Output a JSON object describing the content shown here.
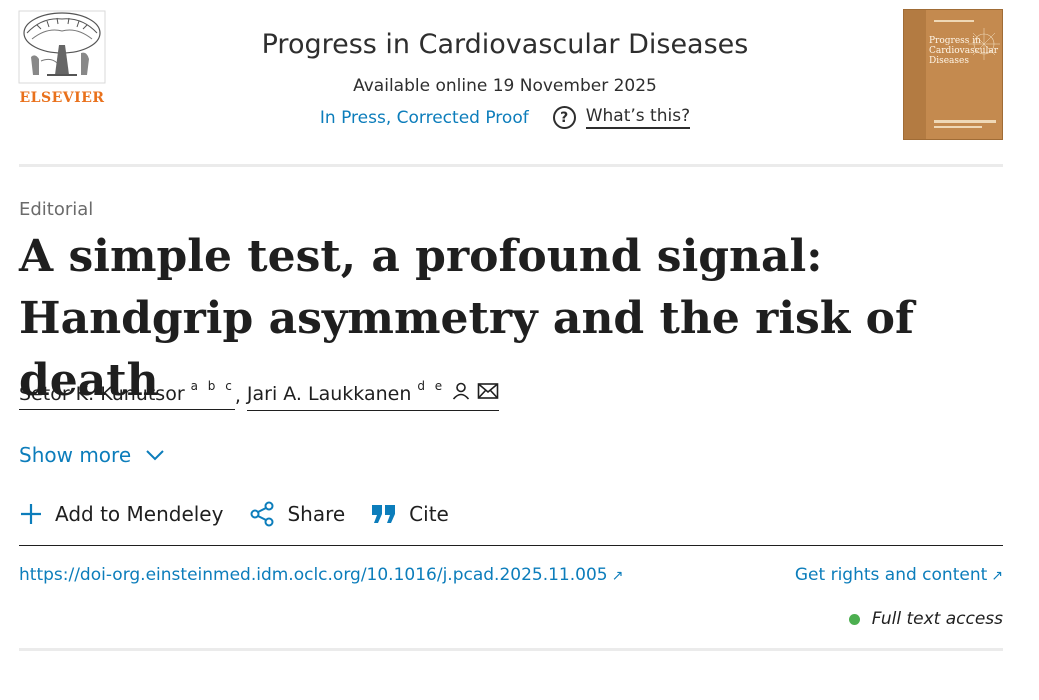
{
  "header": {
    "publisher": "ELSEVIER",
    "journal_title": "Progress in Cardiovascular Diseases",
    "available": "Available online 19 November 2025",
    "status": "In Press, Corrected Proof",
    "whats_this": "What’s this?",
    "cover_title": "Progress in Cardiovascular Diseases"
  },
  "article": {
    "type": "Editorial",
    "title": "A simple test, a profound signal: Handgrip asymmetry and the risk of death",
    "authors": [
      {
        "name": "Setor K. Kunutsor",
        "affiliations": "a b c"
      },
      {
        "name": "Jari A. Laukkanen",
        "affiliations": "d e"
      }
    ],
    "show_more": "Show more"
  },
  "actions": {
    "mendeley": "Add to Mendeley",
    "share": "Share",
    "cite": "Cite"
  },
  "links": {
    "doi": "https://doi-org.einsteinmed.idm.oclc.org/10.1016/j.pcad.2025.11.005",
    "rights": "Get rights and content",
    "access": "Full text access"
  },
  "colors": {
    "link": "#0c7dbb",
    "publisher": "#e9711c",
    "access_dot": "#4caf50"
  }
}
